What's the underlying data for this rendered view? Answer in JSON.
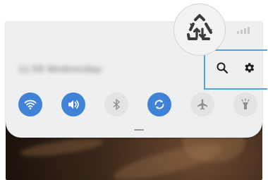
{
  "icons": {
    "callout": "data-saver-icon",
    "search": "search-icon",
    "settings": "gear-icon"
  },
  "datetime_blurred": "11:58 Wednesday",
  "quick_toggles": [
    {
      "name": "wifi",
      "icon": "wifi-icon",
      "state": "on"
    },
    {
      "name": "sound",
      "icon": "speaker-icon",
      "state": "on"
    },
    {
      "name": "bluetooth",
      "icon": "bluetooth-icon",
      "state": "off"
    },
    {
      "name": "auto-rotate",
      "icon": "rotate-icon",
      "state": "on"
    },
    {
      "name": "airplane-mode",
      "icon": "airplane-icon",
      "state": "off"
    },
    {
      "name": "flashlight",
      "icon": "flashlight-icon",
      "state": "off"
    }
  ],
  "colors": {
    "toggle_on": "#3f82d8",
    "toggle_off": "#e2e3e5",
    "highlight": "#4fa4dc",
    "panel": "#eeeff1"
  }
}
